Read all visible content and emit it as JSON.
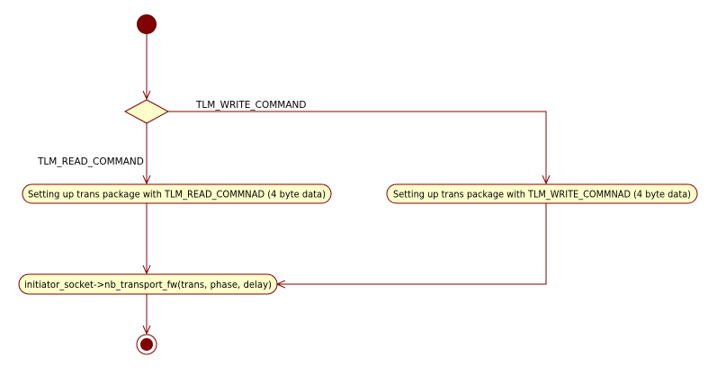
{
  "diagram": {
    "type": "uml-activity",
    "colors": {
      "line": "#800000",
      "node_fill": "#ffffcc",
      "node_stroke": "#800000",
      "initial_fill": "#800000"
    },
    "guards": {
      "write": "TLM_WRITE_COMMAND",
      "read": "TLM_READ_COMMAND"
    },
    "actions": {
      "read_setup": "Setting up trans package with TLM_READ_COMMNAD (4 byte data)",
      "write_setup": "Setting up trans package with TLM_WRITE_COMMNAD (4 byte data)",
      "transport": "initiator_socket->nb_transport_fw(trans, phase, delay)"
    },
    "nodes": [
      "initial-node",
      "decision-node",
      "read-setup-action",
      "write-setup-action",
      "transport-action",
      "final-node"
    ],
    "edges": [
      {
        "from": "initial-node",
        "to": "decision-node"
      },
      {
        "from": "decision-node",
        "to": "read-setup-action",
        "guard": "TLM_READ_COMMAND"
      },
      {
        "from": "decision-node",
        "to": "write-setup-action",
        "guard": "TLM_WRITE_COMMAND"
      },
      {
        "from": "read-setup-action",
        "to": "transport-action"
      },
      {
        "from": "write-setup-action",
        "to": "transport-action"
      },
      {
        "from": "transport-action",
        "to": "final-node"
      }
    ]
  }
}
